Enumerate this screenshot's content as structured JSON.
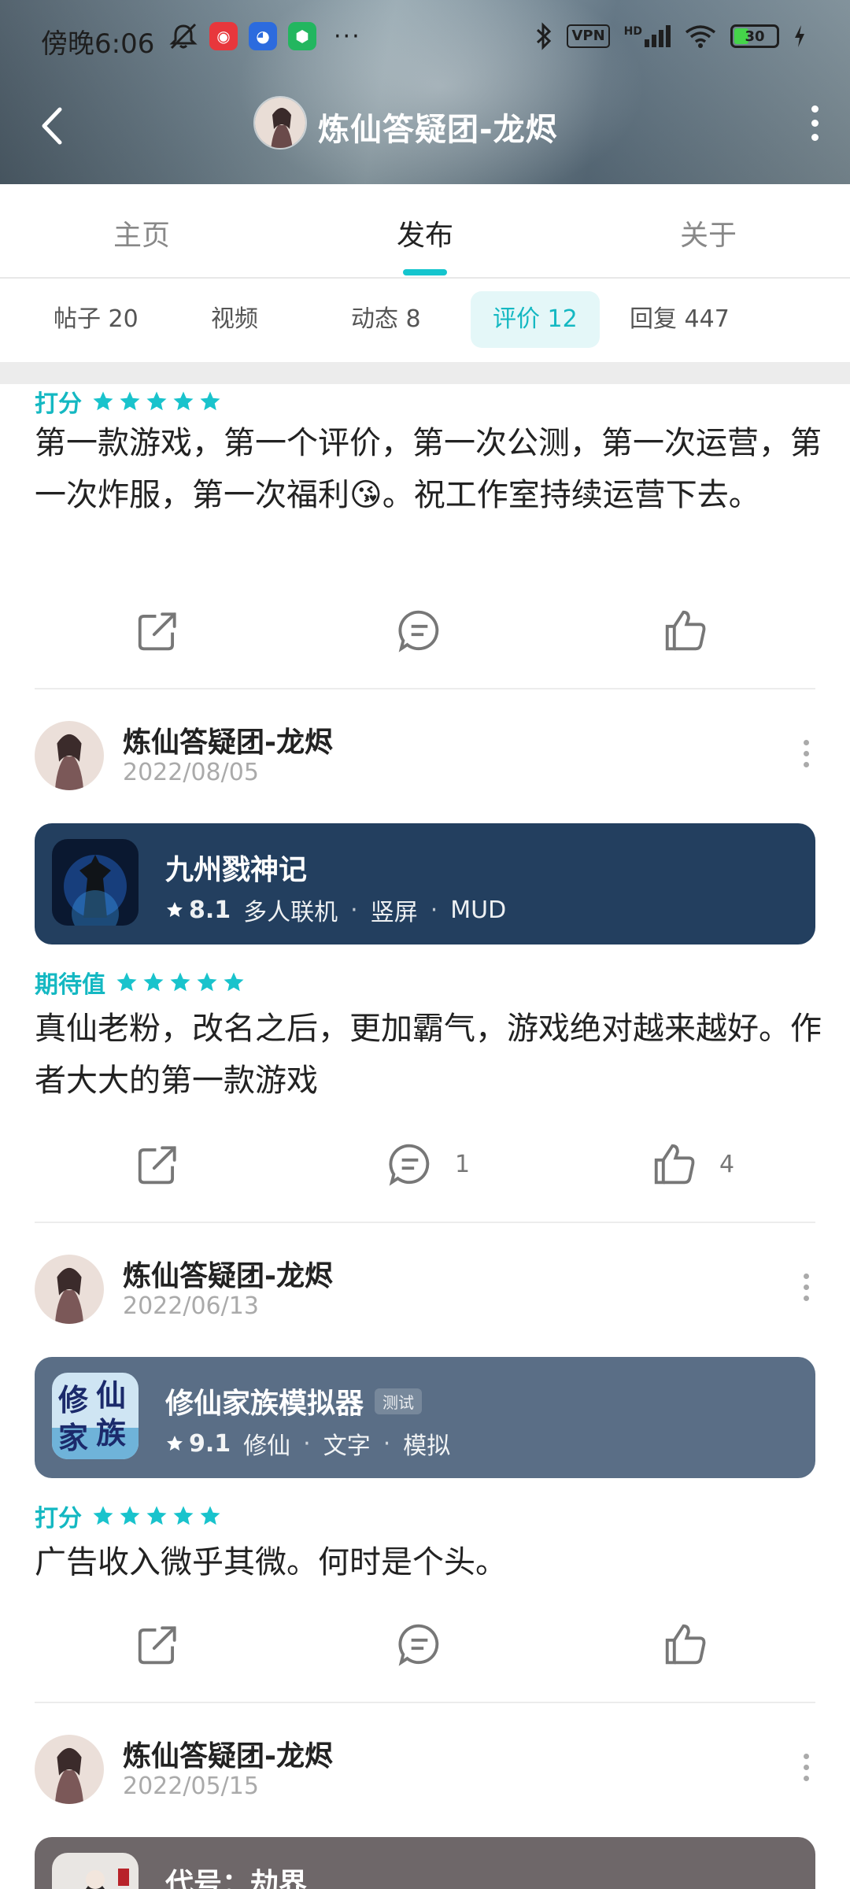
{
  "status_bar": {
    "time": "傍晚6:06",
    "vpn": "VPN",
    "network": "HD",
    "battery": "30",
    "more": "···"
  },
  "nav": {
    "title": "炼仙答疑团-龙烬"
  },
  "main_tabs": [
    {
      "label": "主页"
    },
    {
      "label": "发布"
    },
    {
      "label": "关于"
    }
  ],
  "sub_tabs": [
    {
      "label": "帖子 20"
    },
    {
      "label": "视频"
    },
    {
      "label": "动态 8"
    },
    {
      "label": "评价 12"
    },
    {
      "label": "回复 447"
    }
  ],
  "colors": {
    "accent": "#14b8c2",
    "card1": "#233f5f",
    "card2": "#5a6e86",
    "card3": "#6e6769"
  },
  "reviews": [
    {
      "rating_label": "打分",
      "text": "第一款游戏，第一个评价，第一次公测，第一次运营，第一次炸服，第一次福利😘。祝工作室持续运营下去。",
      "comment_count": "",
      "like_count": ""
    },
    {
      "user": "炼仙答疑团-龙烬",
      "date": "2022/08/05",
      "game": {
        "name": "九州戮神记",
        "badge": "",
        "score": "8.1",
        "tags": [
          "多人联机",
          "竖屏",
          "MUD"
        ]
      },
      "rating_label": "期待值",
      "text": "真仙老粉，改名之后，更加霸气，游戏绝对越来越好。作者大大的第一款游戏",
      "comment_count": "1",
      "like_count": "4"
    },
    {
      "user": "炼仙答疑团-龙烬",
      "date": "2022/06/13",
      "game": {
        "name": "修仙家族模拟器",
        "badge": "测试",
        "score": "9.1",
        "tags": [
          "修仙",
          "文字",
          "模拟"
        ]
      },
      "rating_label": "打分",
      "text": "广告收入微乎其微。何时是个头。",
      "comment_count": "",
      "like_count": ""
    },
    {
      "user": "炼仙答疑团-龙烬",
      "date": "2022/05/15",
      "game": {
        "name": "代号：劫界"
      }
    }
  ]
}
